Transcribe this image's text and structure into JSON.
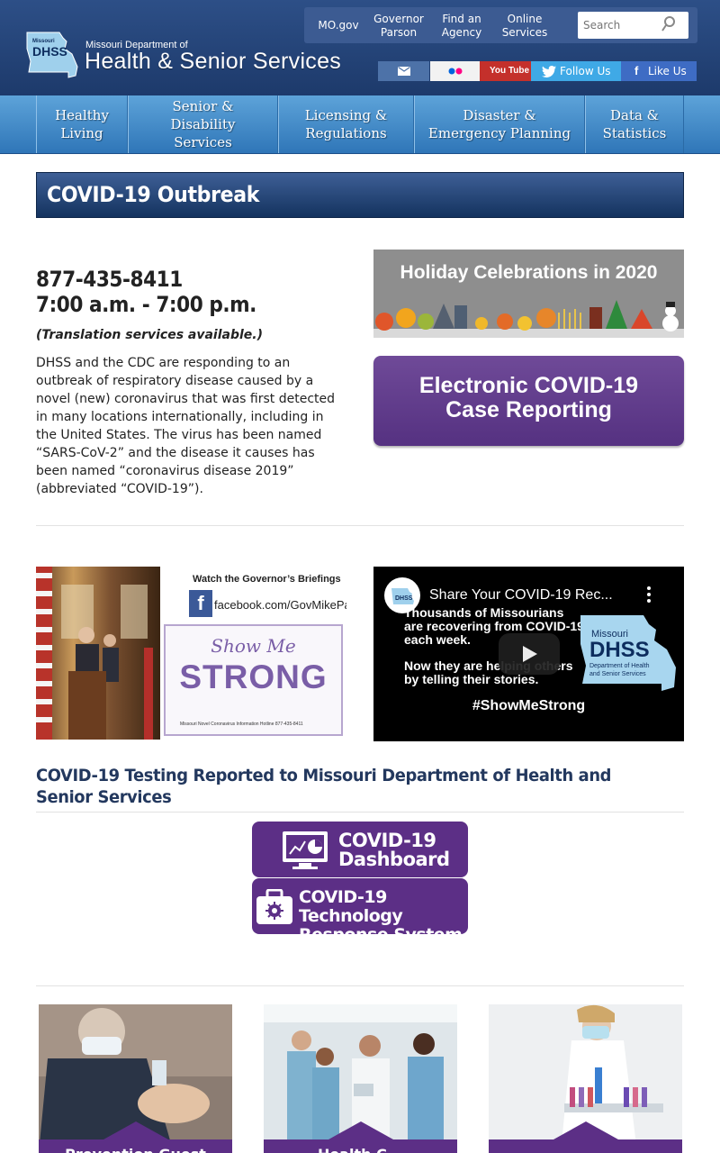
{
  "header": {
    "logo_state_line1": "Missouri",
    "logo_state_abbr": "DHSS",
    "logo_state_line2": "Department of Health and Senior Services",
    "dept_line": "Missouri Department of",
    "dept_name": "Health & Senior Services",
    "top_links": [
      {
        "label": "MO.gov"
      },
      {
        "label": "Governor Parson"
      },
      {
        "label": "Find an Agency"
      },
      {
        "label": "Online Services"
      }
    ],
    "search_placeholder": "Search",
    "social": {
      "email_icon": "envelope-icon",
      "flickr_icon": "flickr-icon",
      "youtube_label": "You Tube",
      "twitter_label": "Follow Us",
      "facebook_label": "Like Us"
    }
  },
  "nav": [
    {
      "label": "Healthy Living"
    },
    {
      "label": "Senior & Disability Services"
    },
    {
      "label": "Licensing & Regulations"
    },
    {
      "label": "Disaster & Emergency Planning"
    },
    {
      "label": "Data & Statistics"
    }
  ],
  "page_title": "COVID-19 Outbreak",
  "intro": {
    "phone": "877-435-8411",
    "hours": "7:00 a.m. - 7:00 p.m.",
    "translation": "(Translation services available.)",
    "body": "DHSS and the CDC are responding to an outbreak of respiratory disease caused by a novel (new) coronavirus that was first detected in many locations internationally, including in the United States. The virus has been named “SARS-CoV-2” and the disease it causes has been named “coronavirus disease 2019” (abbreviated “COVID-19”)."
  },
  "holiday_banner": "Holiday Celebrations in 2020",
  "ecr_banner": {
    "line1": "Electronic COVID-19",
    "line2": "Case Reporting"
  },
  "gov_briefing": {
    "watch": "Watch the Governor’s Briefings",
    "fb_url": "facebook.com/GovMikeParson",
    "show": "Show Me",
    "strong": "STRONG",
    "hotline": "Missouri Novel Coronavirus Information Hotline  877-435-8411"
  },
  "video": {
    "title": "Share Your COVID-19 Rec...",
    "line1": "Thousands of Missourians",
    "line2": "are recovering from COVID-19",
    "line3": "each week.",
    "line4": "Now they are helping others",
    "line5": "by telling their stories.",
    "hashtag": "#ShowMeStrong",
    "badge_state": "Missouri",
    "badge_abbr": "DHSS",
    "badge_sub": "Department of Health and Senior Services"
  },
  "testing": {
    "title": "COVID-19 Testing Reported to Missouri Department of Health and Senior Services",
    "dashboard_line1": "COVID-19",
    "dashboard_line2": "Dashboard",
    "tech_line1": "COVID-19 Technology",
    "tech_line2": "Response System"
  },
  "cards": [
    {
      "label": "Prevention Guest"
    },
    {
      "label": "Health C..."
    },
    {
      "label": ""
    }
  ],
  "colors": {
    "header_blue": "#1d3a6b",
    "nav_blue": "#2f76b8",
    "purple": "#5c2f86",
    "title_text": "#23385e"
  }
}
